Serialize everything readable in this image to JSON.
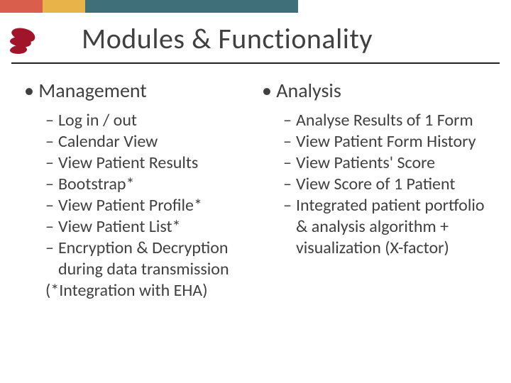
{
  "title": "Modules & Functionality",
  "left": {
    "heading": "Management",
    "items": [
      "Log in / out",
      "Calendar View",
      "View Patient Results",
      "Bootstrap*",
      "View Patient Profile*",
      "View Patient List*",
      "Encryption & Decryption during data transmission"
    ],
    "note": "(*Integration with EHA)"
  },
  "right": {
    "heading": "Analysis",
    "items": [
      "Analyse Results of 1 Form",
      "View Patient Form History",
      "View Patients' Score",
      "View Score of 1 Patient",
      "Integrated patient portfolio & analysis algorithm + visualization (X-factor)"
    ]
  }
}
